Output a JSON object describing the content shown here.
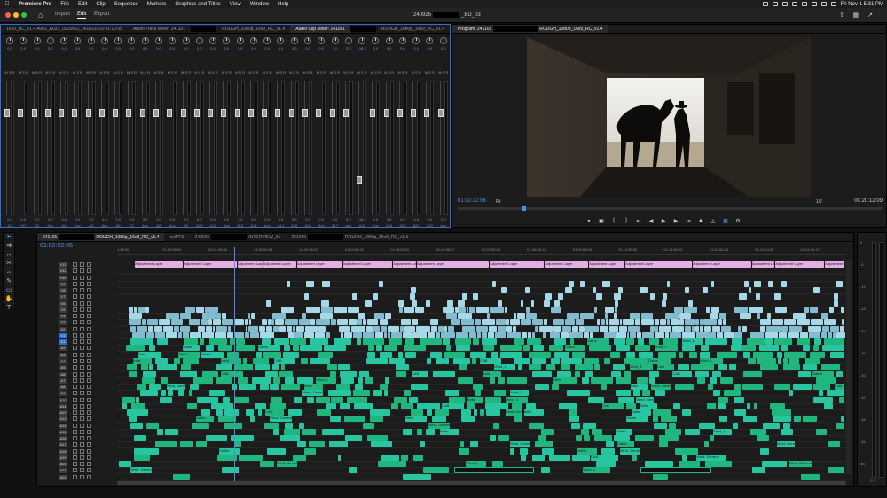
{
  "menubar": {
    "app_name": "Premiere Pro",
    "items": [
      "File",
      "Edit",
      "Clip",
      "Sequence",
      "Markers",
      "Graphics and Titles",
      "View",
      "Window",
      "Help"
    ],
    "clock": "Fri Nov 1  5:31 PM"
  },
  "header": {
    "tabs": [
      "Import",
      "Edit",
      "Export"
    ],
    "active_tab": "Edit",
    "project_title_prefix": "240925",
    "project_title_suffix": "_BD_03"
  },
  "mixer_panel": {
    "tabs": [
      {
        "label": "16x9_RC_v1.4  A002_A033_0215MU_061R2D  15:01:10:05",
        "active": false
      },
      {
        "label": "Audio Track Mixer: 241101",
        "active": false
      },
      {
        "label": "ROUGH_1080p_16x9_RC_v1.4",
        "active": false
      },
      {
        "label": "Audio Clip Mixer: 241101",
        "active": true
      },
      {
        "label": "ROUGH_1080p_16x9_RC_v1.4",
        "active": false
      }
    ],
    "strips": [
      {
        "label": "A2",
        "value": "0.0"
      },
      {
        "label": "VO",
        "value": "0.0"
      },
      {
        "label": "A3",
        "value": "0.0"
      },
      {
        "label": "Aux",
        "value": "0.0"
      },
      {
        "label": "A4",
        "value": "0.0"
      },
      {
        "label": "Aux",
        "value": "0.0"
      },
      {
        "label": "A5",
        "value": "0.0"
      },
      {
        "label": "Aux",
        "value": "0.0"
      },
      {
        "label": "A6",
        "value": "0.0"
      },
      {
        "label": "A7",
        "value": "0.0"
      },
      {
        "label": "Aux",
        "value": "0.0"
      },
      {
        "label": "A8",
        "value": "0.0"
      },
      {
        "label": "Aux",
        "value": "0.0"
      },
      {
        "label": "A9",
        "value": "0.0"
      },
      {
        "label": "A10",
        "value": "0.0"
      },
      {
        "label": "A11",
        "value": "0.0"
      },
      {
        "label": "Aux",
        "value": "0.0"
      },
      {
        "label": "A12",
        "value": "0.0"
      },
      {
        "label": "A13",
        "value": "0.0"
      },
      {
        "label": "Aux",
        "value": "0.0"
      },
      {
        "label": "A14",
        "value": "0.0"
      },
      {
        "label": "A15",
        "value": "0.0"
      },
      {
        "label": "A16",
        "value": "0.0"
      },
      {
        "label": "Aux",
        "value": "0.0"
      },
      {
        "label": "A17",
        "value": "0.0"
      },
      {
        "label": "Aux",
        "value": "0.0"
      },
      {
        "label": "A18",
        "value": "-18.3"
      },
      {
        "label": "Aux",
        "value": "0.0"
      },
      {
        "label": "A19",
        "value": "0.0"
      },
      {
        "label": "A20",
        "value": "0.0"
      },
      {
        "label": "A21",
        "value": "0.0"
      },
      {
        "label": "A22",
        "value": "0.0"
      },
      {
        "label": "Aux",
        "value": "0.0"
      }
    ],
    "msr": "M S R"
  },
  "program": {
    "tab_prefix": "Program: 241101",
    "tab_suffix": "ROUGH_1080p_16x9_RC_v1.4",
    "timecode": "01:02:22:06",
    "fit": "Fit",
    "quality": "1/2",
    "duration": "00:20:12:09"
  },
  "timeline": {
    "tabs": [
      {
        "label": "241101",
        "suffix": "ROUGH_1080p_16x9_RC_v1.4",
        "active": true
      },
      {
        "label": "selPTS",
        "suffix": "",
        "active": false
      },
      {
        "label": "240926",
        "suffix": "INTERVIEW_01",
        "active": false
      },
      {
        "label": "241030",
        "suffix": "ROUGH_1080p_16x9_RC_v1.3",
        "active": false
      }
    ],
    "timecode": "01:02:22:06",
    "ruler_ticks": [
      "1:58:00",
      "01:00:56:09",
      "01:01:56:06",
      "01:02:56:03",
      "01:03:56:00",
      "01:04:55:23",
      "01:05:55:20",
      "01:06:55:17",
      "01:07:55:14",
      "01:08:55:11",
      "01:09:55:08",
      "01:10:55:05",
      "01:11:55:02",
      "01:12:54:23",
      "01:13:54:20",
      "01:14:54:17"
    ],
    "video_tracks": [
      "V12",
      "V11",
      "V10",
      "V9",
      "V8",
      "V7",
      "V6",
      "V5",
      "V4",
      "V3",
      "V2",
      "V1"
    ],
    "audio_tracks": [
      "A1",
      "A2",
      "A3",
      "A4",
      "A5",
      "A6",
      "A7",
      "A8",
      "A9",
      "A10",
      "A11",
      "A12",
      "A13",
      "A14",
      "A15",
      "A16",
      "A17",
      "A18",
      "A19",
      "A20",
      "A21",
      "A22"
    ],
    "adjustment_label": "Adjustment Layer",
    "clip_labels": {
      "wind": "Wind_1",
      "wind_general": "Wind, General",
      "gather": "Gathe",
      "cab": "CAB",
      "bells": "Bells",
      "adjust": "Adjust"
    }
  },
  "meters": {
    "scale": [
      "0",
      "-6",
      "-12",
      "-18",
      "-24",
      "-30",
      "-36",
      "-42",
      "-48",
      "-54",
      "dB"
    ],
    "footer": "S  S"
  }
}
